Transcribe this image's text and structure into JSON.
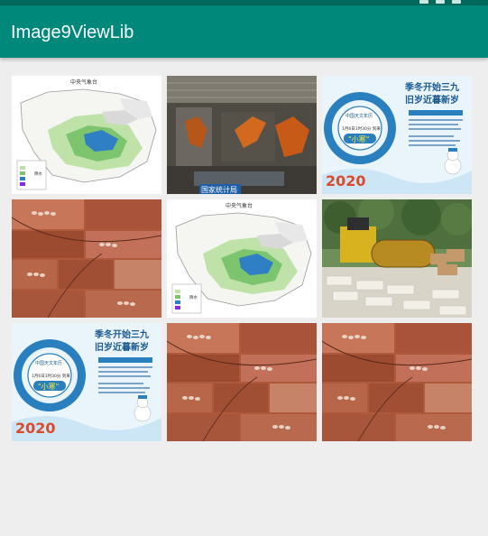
{
  "app": {
    "title": "Image9ViewLib"
  },
  "colors": {
    "status_bar": "#00695c",
    "app_bar": "#00897b",
    "background": "#eeeeee"
  },
  "grid": {
    "columns": 3,
    "rows": 3,
    "images": [
      {
        "kind": "weather-map",
        "header": "中央气象台",
        "legend_title": "降水",
        "legend_sub": "(单位：毫米)"
      },
      {
        "kind": "factory-photo",
        "caption": "国家统计局"
      },
      {
        "kind": "solar-term-poster",
        "title_line1": "季冬开始三九",
        "title_line2": "旧岁近暮新岁",
        "circle_text": "中国天文年历",
        "term": "\"小寒\"",
        "date_text": "1月6日3时30分 到来",
        "year": "2020"
      },
      {
        "kind": "rock-texture"
      },
      {
        "kind": "weather-map",
        "header": "中央气象台",
        "legend_title": "降水",
        "legend_sub": "(单位：毫米)"
      },
      {
        "kind": "roller-photo"
      },
      {
        "kind": "solar-term-poster",
        "title_line1": "季冬开始三九",
        "title_line2": "旧岁近暮新岁",
        "circle_text": "中国天文年历",
        "term": "\"小寒\"",
        "date_text": "1月6日3时30分 到来",
        "year": "2020"
      },
      {
        "kind": "rock-texture"
      },
      {
        "kind": "rock-texture"
      }
    ]
  }
}
